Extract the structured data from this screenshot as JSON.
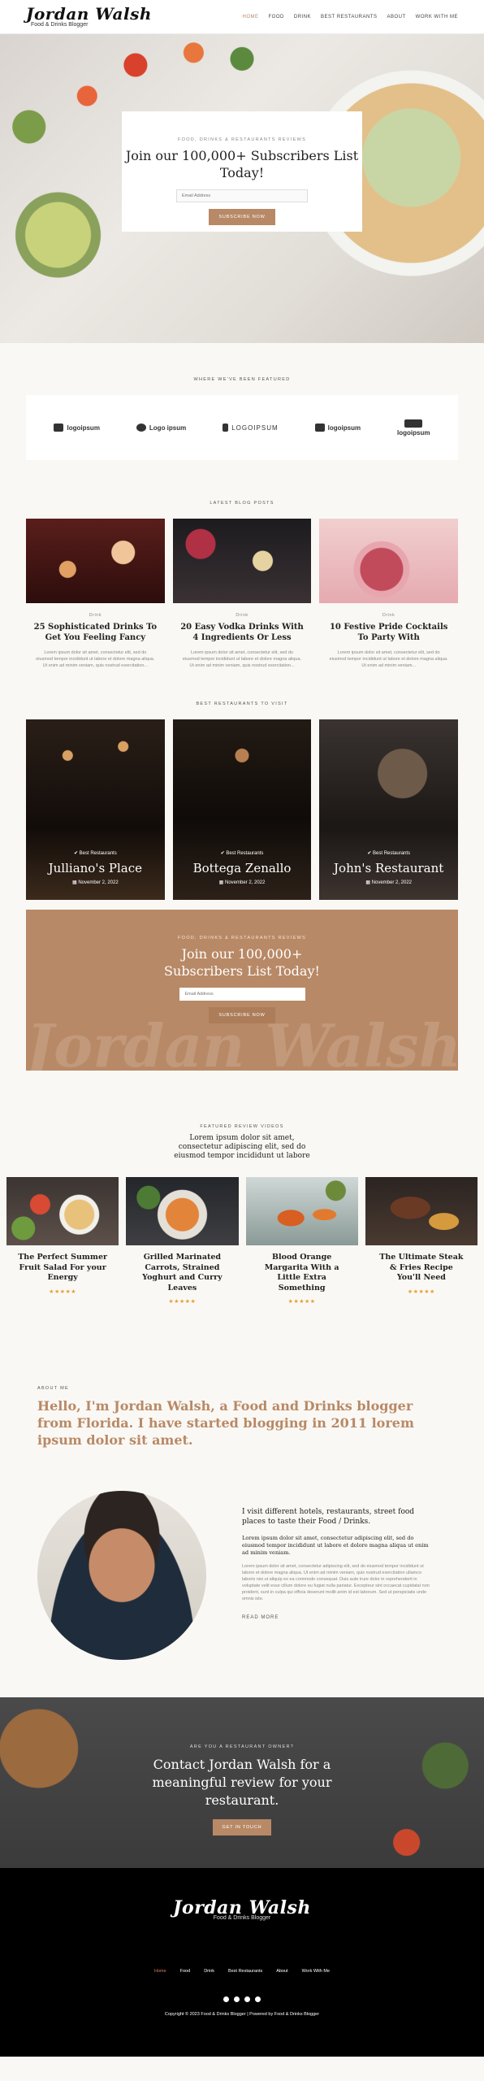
{
  "header": {
    "logo": "Jordan Walsh",
    "tagline": "Food & Drinks Blogger",
    "nav": [
      "Home",
      "Food",
      "Drink",
      "Best Restaurants",
      "About",
      "Work with me"
    ]
  },
  "hero": {
    "eyebrow": "Food, Drinks & Restaurants Reviews",
    "title": "Join our 100,000+ Subscribers List Today!",
    "email_placeholder": "Email Address",
    "button": "Subscribe Now"
  },
  "featured": {
    "label": "Where we've been featured",
    "logos": [
      "logoipsum",
      "Logo ipsum",
      "LOGOIPSUM",
      "logoipsum",
      "logoipsum"
    ]
  },
  "blog": {
    "label": "Latest Blog Posts",
    "posts": [
      {
        "category": "Drink",
        "title": "25 Sophisticated Drinks To Get You Feeling Fancy",
        "excerpt": "Lorem ipsum dolor sit amet, consectetur elit, sed do eiusmod tempor incididunt ut labore et dolore magna aliqua. Ut enim ad minim veniam, quis nostrud exercitation..."
      },
      {
        "category": "Drink",
        "title": "20 Easy Vodka Drinks With 4 Ingredients Or Less",
        "excerpt": "Lorem ipsum dolor sit amet, consectetur elit, sed do eiusmod tempor incididunt ut labore et dolore magna aliqua. Ut enim ad minim veniam, quis nostrud exercitation..."
      },
      {
        "category": "Drink",
        "title": "10 Festive Pride Cocktails To Party With",
        "excerpt": "Lorem ipsum dolor sit amet, consectetur elit, sed do eiusmod tempor incididunt ut labore et dolore magna aliqua. Ut enim ad minim veniam..."
      }
    ]
  },
  "restaurants": {
    "label": "Best Restaurants to Visit",
    "items": [
      {
        "category": "Best Restaurants",
        "name": "Julliano's Place",
        "date": "November 2, 2022"
      },
      {
        "category": "Best Restaurants",
        "name": "Bottega Zenallo",
        "date": "November 2, 2022"
      },
      {
        "category": "Best Restaurants",
        "name": "John's Restaurant",
        "date": "November 2, 2022"
      }
    ]
  },
  "newsletter": {
    "eyebrow": "Food, Drinks & Restaurants Reviews",
    "title": "Join our 100,000+ Subscribers List Today!",
    "email_placeholder": "Email Address",
    "button": "Subscribe Now",
    "watermark": "Jordan Walsh"
  },
  "videos": {
    "label": "Featured Review Videos",
    "subtitle": "Lorem ipsum dolor sit amet, consectetur adipiscing elit, sed do eiusmod tempor incididunt ut labore",
    "items": [
      {
        "title": "The Perfect Summer Fruit Salad For your Energy",
        "stars": "★★★★★"
      },
      {
        "title": "Grilled Marinated Carrots, Strained Yoghurt and Curry Leaves",
        "stars": "★★★★★"
      },
      {
        "title": "Blood Orange Margarita With a Little Extra Something",
        "stars": "★★★★★"
      },
      {
        "title": "The Ultimate Steak & Fries Recipe You'll Need",
        "stars": "★★★★★"
      }
    ]
  },
  "about": {
    "label": "About Me",
    "headline": "Hello, I'm Jordan Walsh, a Food and Drinks blogger from Florida. I have started blogging in 2011 lorem ipsum dolor sit amet.",
    "intro": "I visit different hotels, restaurants, street food places to taste their Food / Drinks.",
    "bold": "Lorem ipsum dolor sit amet, consectetur adipiscing elit, sed do eiusmod tempor incididunt ut labore et dolore magna aliqua ut enim ad minim veniam.",
    "para": "Lorem ipsum dolor sit amet, consectetur adipiscing elit, sed do eiusmod tempor incididunt ut labore et dolore magna aliqua. Ut enim ad minim veniam, quis nostrud exercitation ullamco laboris nisi ut aliquip ex ea commodo consequat. Duis aute irure dolor in reprehenderit in voluptate velit esse cillum dolore eu fugiat nulla pariatur. Excepteur sint occaecat cupidatat non proident, sunt in culpa qui officia deserunt mollit anim id est laborum. Sed ut perspiciatis unde omnis iste.",
    "read_more": "Read More"
  },
  "contact": {
    "eyebrow": "Are you a restaurant owner?",
    "title": "Contact Jordan Walsh for a meaningful review for your restaurant.",
    "button": "Get in Touch"
  },
  "footer": {
    "logo": "Jordan Walsh",
    "tagline": "Food & Drinks Blogger",
    "nav": [
      "Home",
      "Food",
      "Drink",
      "Best Restaurants",
      "About",
      "Work With Me"
    ],
    "copyright": "Copyright © 2023 Food & Drinks Blogger | Powered by Food & Drinks Blogger"
  },
  "colors": {
    "accent": "#b88966",
    "footer_bg": "#000000",
    "active_footer": "#e07b5b"
  }
}
